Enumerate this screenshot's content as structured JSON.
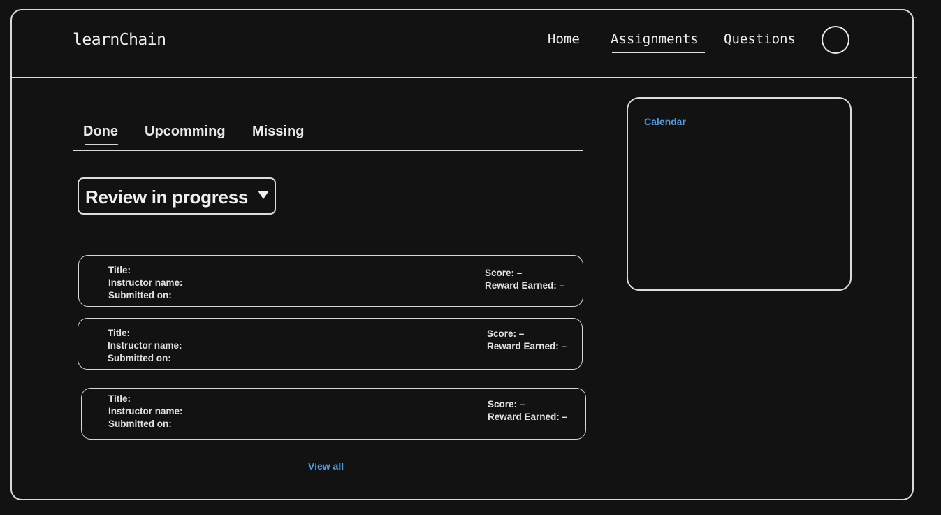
{
  "header": {
    "logo": "learnChain",
    "nav": {
      "home": "Home",
      "assignments": "Assignments",
      "questions": "Questions"
    },
    "active_nav": "Assignments"
  },
  "tabs": {
    "done": "Done",
    "upcoming": "Upcomming",
    "missing": "Missing",
    "active": "Done"
  },
  "filter": {
    "selected": "Review in progress"
  },
  "assignments": [
    {
      "title_label": "Title:",
      "instructor_label": "Instructor name:",
      "submitted_label": "Submitted on:",
      "score_label": "Score: –",
      "reward_label": "Reward Earned: –"
    },
    {
      "title_label": "Title:",
      "instructor_label": "Instructor name:",
      "submitted_label": "Submitted on:",
      "score_label": "Score: –",
      "reward_label": "Reward Earned: –"
    },
    {
      "title_label": "Title:",
      "instructor_label": "Instructor name:",
      "submitted_label": "Submitted on:",
      "score_label": "Score: –",
      "reward_label": "Reward Earned: –"
    }
  ],
  "view_all": "View all",
  "calendar": {
    "title": "Calendar"
  },
  "colors": {
    "background": "#121212",
    "stroke": "#d9d9d9",
    "link": "#4f9ee0"
  }
}
